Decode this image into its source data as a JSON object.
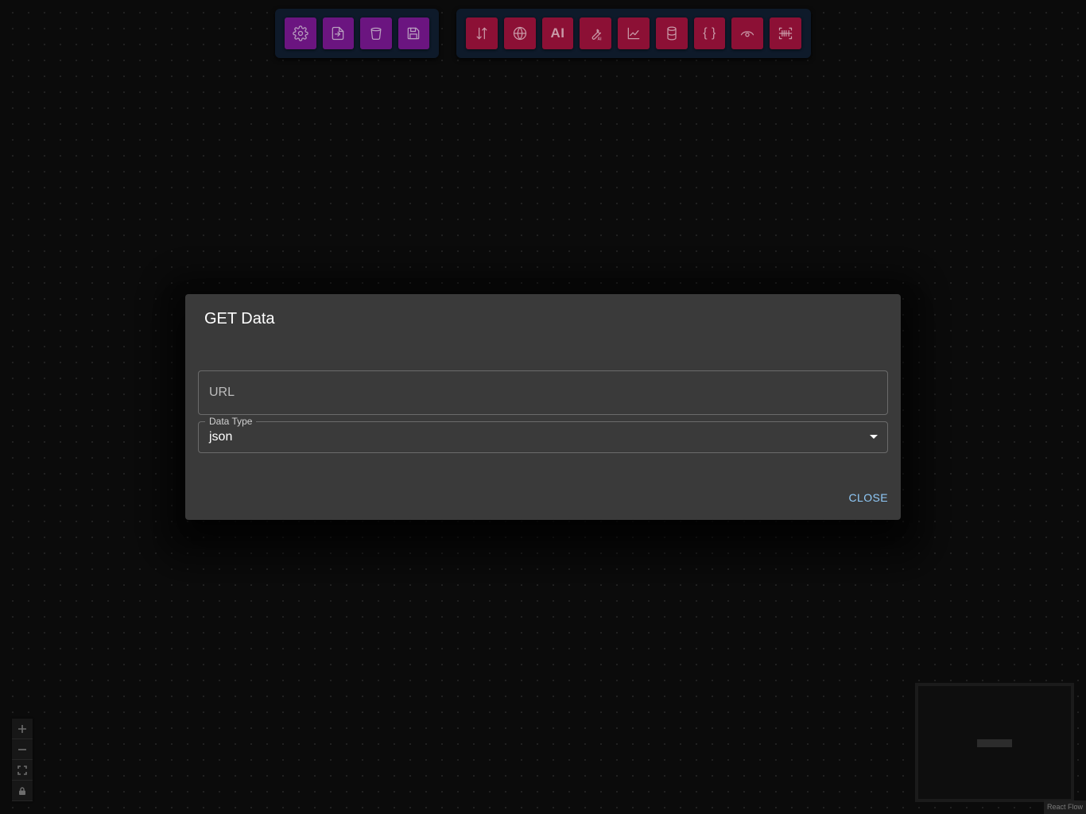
{
  "toolbar_left": {
    "buttons": [
      {
        "icon": "gear-icon"
      },
      {
        "icon": "import-icon"
      },
      {
        "icon": "trash-icon"
      },
      {
        "icon": "save-icon"
      }
    ]
  },
  "toolbar_right": {
    "buttons": [
      {
        "icon": "sort-arrows-icon"
      },
      {
        "icon": "www-globe-icon"
      },
      {
        "icon": "ai-text-icon",
        "label": "AI"
      },
      {
        "icon": "ai-wrench-icon",
        "label": "AI"
      },
      {
        "icon": "line-chart-icon"
      },
      {
        "icon": "database-icon"
      },
      {
        "icon": "curly-braces-icon",
        "label": "{ }"
      },
      {
        "icon": "eye-icon"
      },
      {
        "icon": "barcode-scan-icon"
      }
    ]
  },
  "dialog": {
    "title": "GET Data",
    "url_placeholder": "URL",
    "url_value": "",
    "data_type_label": "Data Type",
    "data_type_value": "json",
    "close_label": "CLOSE"
  },
  "controls": {
    "items": [
      {
        "icon": "plus-icon"
      },
      {
        "icon": "minus-icon"
      },
      {
        "icon": "fit-view-icon"
      },
      {
        "icon": "lock-icon"
      }
    ]
  },
  "attribution": "React Flow",
  "colors": {
    "background": "#0b0b0b",
    "toolbar_bg": "#0e1a2a",
    "purple_button": "#6b1580",
    "crimson_button": "#8c1035",
    "dialog_bg": "#3a3a3a",
    "accent_link": "#90caf9"
  }
}
